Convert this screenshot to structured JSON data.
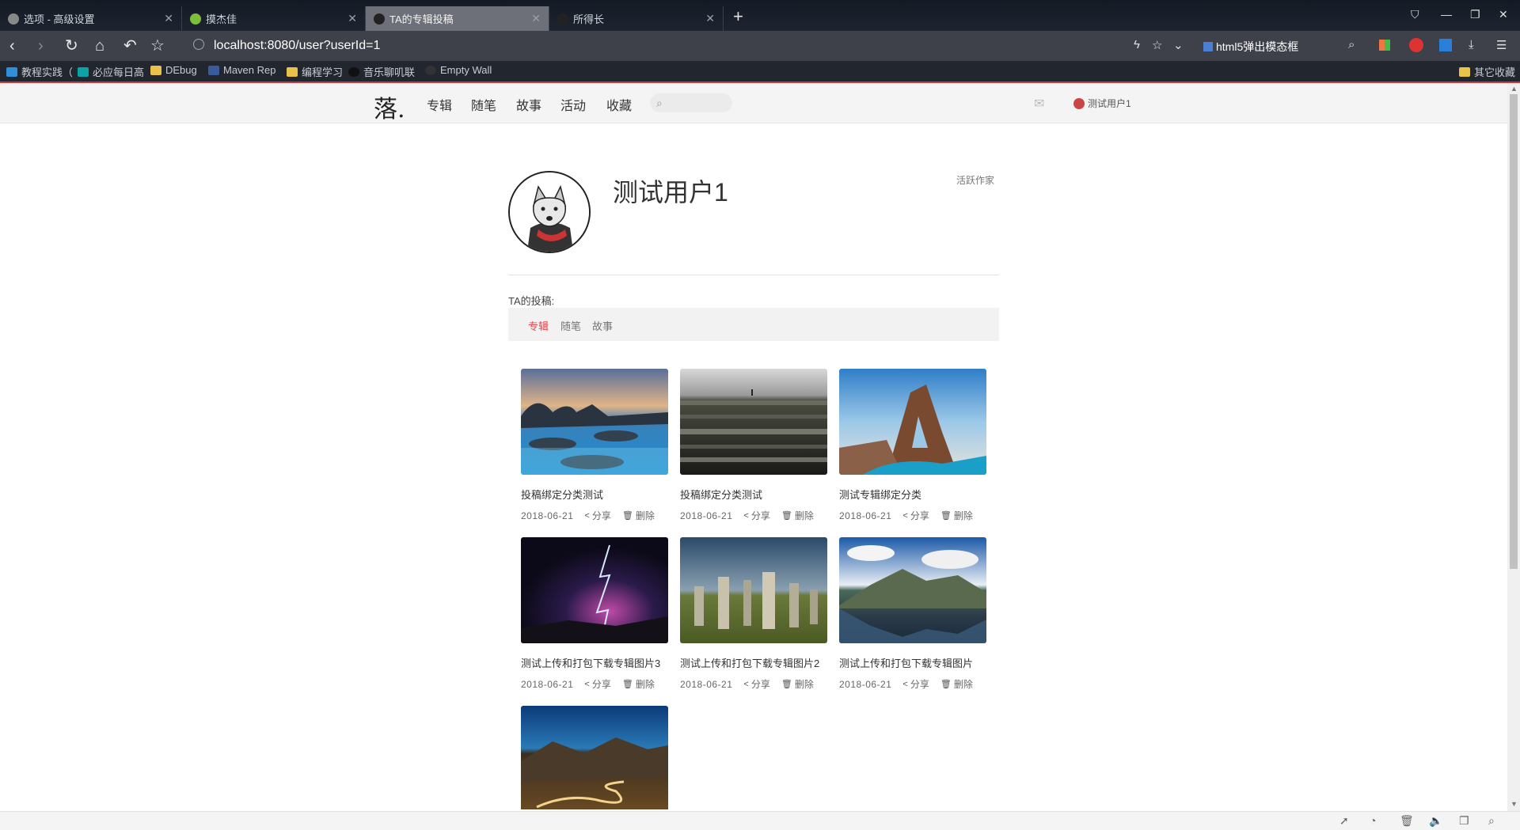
{
  "browser": {
    "tabs": [
      {
        "label": "选项 - 高级设置"
      },
      {
        "label": "摸杰佳"
      },
      {
        "label": "TA的专辑投稿"
      },
      {
        "label": "所得长"
      }
    ],
    "url": "localhost:8080/user?userId=1",
    "extension_title": "html5弹出模态框",
    "bookmarks": [
      {
        "label": "教程实践（"
      },
      {
        "label": "必应每日高"
      },
      {
        "label": "DEbug"
      },
      {
        "label": "Maven Rep"
      },
      {
        "label": "编程学习"
      },
      {
        "label": "音乐聊叽联"
      },
      {
        "label": "Empty Wall"
      },
      {
        "label": "其它收藏"
      }
    ]
  },
  "site": {
    "logo": "落.",
    "nav": [
      {
        "label": "专辑"
      },
      {
        "label": "随笔"
      },
      {
        "label": "故事"
      },
      {
        "label": "活动"
      },
      {
        "label": "收藏"
      }
    ],
    "user": "测试用户1"
  },
  "profile": {
    "name": "测试用户1",
    "badge": "活跃作家",
    "contributions_label": "TA的投稿:",
    "tabs": [
      {
        "label": "专辑",
        "active": true
      },
      {
        "label": "随笔",
        "active": false
      },
      {
        "label": "故事",
        "active": false
      }
    ]
  },
  "albums": [
    {
      "title": "投稿绑定分类测试",
      "date": "2018-06-21",
      "share": "分享",
      "delete": "删除",
      "scene": "coast-sunset"
    },
    {
      "title": "投稿绑定分类测试",
      "date": "2018-06-21",
      "share": "分享",
      "delete": "删除",
      "scene": "rock-cliff"
    },
    {
      "title": "测试专辑绑定分类",
      "date": "2018-06-21",
      "share": "分享",
      "delete": "删除",
      "scene": "sea-arch"
    },
    {
      "title": "测试上传和打包下载专辑图片3",
      "date": "2018-06-21",
      "share": "分享",
      "delete": "删除",
      "scene": "lightning"
    },
    {
      "title": "测试上传和打包下载专辑图片2",
      "date": "2018-06-21",
      "share": "分享",
      "delete": "删除",
      "scene": "standing-stones"
    },
    {
      "title": "测试上传和打包下载专辑图片",
      "date": "2018-06-21",
      "share": "分享",
      "delete": "删除",
      "scene": "mountain-lake"
    },
    {
      "title": "",
      "date": "",
      "share": "",
      "delete": "",
      "scene": "mountain-road"
    }
  ]
}
